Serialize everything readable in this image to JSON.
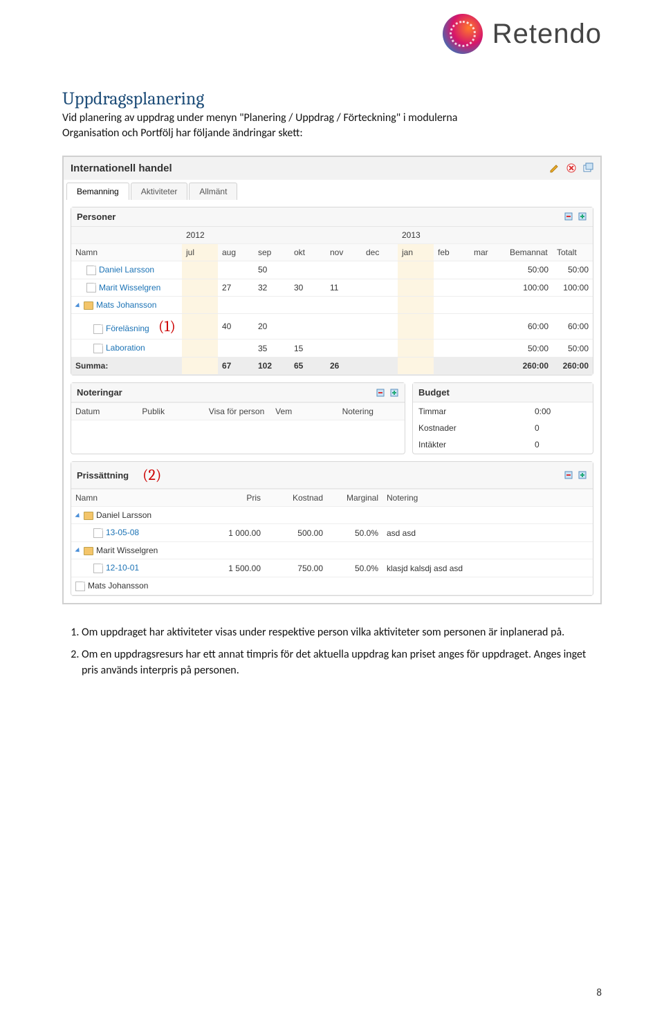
{
  "logo_text": "Retendo",
  "doc": {
    "heading": "Uppdragsplanering",
    "intro_line1": "Vid planering av uppdrag under menyn \"Planering / Uppdrag / Förteckning\" i modulerna",
    "intro_line2": "Organisation och Portfölj har följande ändringar skett:",
    "note1": "Om uppdraget har aktiviteter visas under respektive person vilka aktiviteter som personen är inplanerad på.",
    "note2": "Om en uppdragsresurs har ett annat timpris för det aktuella uppdrag kan priset anges för uppdraget. Anges inget pris används interpris på personen.",
    "page_number": "8"
  },
  "annot": {
    "one": "(1)",
    "two": "(2)"
  },
  "app": {
    "title": "Internationell handel",
    "tabs": [
      "Bemanning",
      "Aktiviteter",
      "Allmänt"
    ],
    "active_tab": "Bemanning",
    "personer": {
      "title": "Personer",
      "year1": "2012",
      "year2": "2013",
      "cols": {
        "namn": "Namn",
        "jul": "jul",
        "aug": "aug",
        "sep": "sep",
        "okt": "okt",
        "nov": "nov",
        "dec": "dec",
        "jan": "jan",
        "feb": "feb",
        "mar": "mar",
        "bemannat": "Bemannat",
        "totalt": "Totalt"
      },
      "rows": {
        "daniel": {
          "name": "Daniel Larsson",
          "sep": "50",
          "bemannat": "50:00",
          "totalt": "50:00"
        },
        "marit": {
          "name": "Marit Wisselgren",
          "aug": "27",
          "sep": "32",
          "okt": "30",
          "nov": "11",
          "bemannat": "100:00",
          "totalt": "100:00"
        },
        "mats": {
          "name": "Mats Johansson"
        },
        "forelasning": {
          "name": "Föreläsning",
          "aug": "40",
          "sep": "20",
          "bemannat": "60:00",
          "totalt": "60:00"
        },
        "laboration": {
          "name": "Laboration",
          "sep": "35",
          "okt": "15",
          "bemannat": "50:00",
          "totalt": "50:00"
        },
        "summa": {
          "name": "Summa:",
          "aug": "67",
          "sep": "102",
          "okt": "65",
          "nov": "26",
          "bemannat": "260:00",
          "totalt": "260:00"
        }
      }
    },
    "noteringar": {
      "title": "Noteringar",
      "cols": {
        "datum": "Datum",
        "publik": "Publik",
        "visa": "Visa för person",
        "vem": "Vem",
        "notering": "Notering"
      }
    },
    "budget": {
      "title": "Budget",
      "timmar_lbl": "Timmar",
      "timmar_val": "0:00",
      "kostnader_lbl": "Kostnader",
      "kostnader_val": "0",
      "intakter_lbl": "Intäkter",
      "intakter_val": "0"
    },
    "prissattning": {
      "title": "Prissättning",
      "cols": {
        "namn": "Namn",
        "pris": "Pris",
        "kostnad": "Kostnad",
        "marginal": "Marginal",
        "notering": "Notering"
      },
      "daniel": {
        "name": "Daniel Larsson"
      },
      "d_row": {
        "name": "13-05-08",
        "pris": "1 000.00",
        "kostnad": "500.00",
        "marginal": "50.0%",
        "notering": "asd asd"
      },
      "marit": {
        "name": "Marit Wisselgren"
      },
      "m_row": {
        "name": "12-10-01",
        "pris": "1 500.00",
        "kostnad": "750.00",
        "marginal": "50.0%",
        "notering": "klasjd kalsdj asd asd"
      },
      "mats": {
        "name": "Mats Johansson"
      }
    }
  }
}
